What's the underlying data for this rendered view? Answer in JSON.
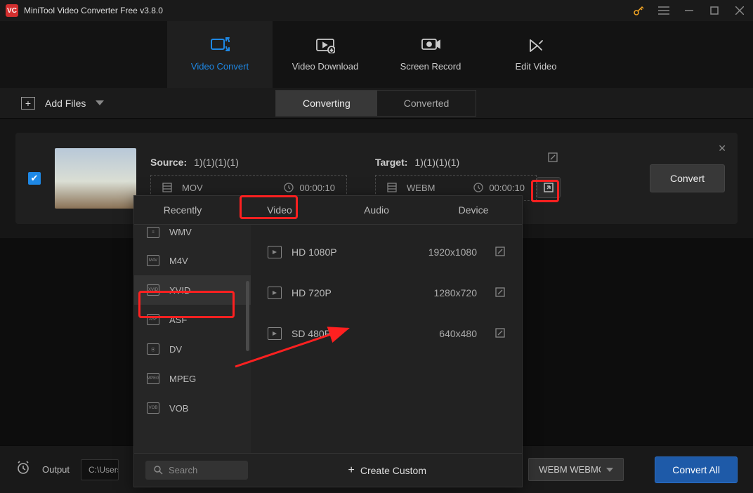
{
  "app": {
    "title": "MiniTool Video Converter Free v3.8.0"
  },
  "tabs": {
    "convert": "Video Convert",
    "download": "Video Download",
    "record": "Screen Record",
    "edit": "Edit Video"
  },
  "toolbar": {
    "add_files": "Add Files",
    "converting": "Converting",
    "converted": "Converted"
  },
  "task": {
    "source_label": "Source:",
    "source_val": "1)(1)(1)(1)",
    "source_codec": "MOV",
    "source_duration": "00:00:10",
    "target_label": "Target:",
    "target_val": "1)(1)(1)(1)",
    "target_codec": "WEBM",
    "target_duration": "00:00:10",
    "convert": "Convert"
  },
  "dropdown": {
    "tabs": {
      "recently": "Recently",
      "video": "Video",
      "audio": "Audio",
      "device": "Device"
    },
    "formats": {
      "wmv": "WMV",
      "m4v": "M4V",
      "xvid": "XVID",
      "asf": "ASF",
      "dv": "DV",
      "mpeg": "MPEG",
      "vob": "VOB"
    },
    "formats_badge": {
      "wmv": "",
      "m4v": "M4V",
      "xvid": "XVID",
      "asf": "ASF",
      "dv": "",
      "mpeg": "MPEG",
      "vob": "VOB"
    },
    "res": [
      {
        "name": "HD 1080P",
        "dim": "1920x1080"
      },
      {
        "name": "HD 720P",
        "dim": "1280x720"
      },
      {
        "name": "SD 480P",
        "dim": "640x480"
      }
    ],
    "search": "Search",
    "create": "Create Custom"
  },
  "footer": {
    "output_label": "Output",
    "output_path": "C:\\Users",
    "codec": "WEBM WEBMCus",
    "convert_all": "Convert All"
  }
}
